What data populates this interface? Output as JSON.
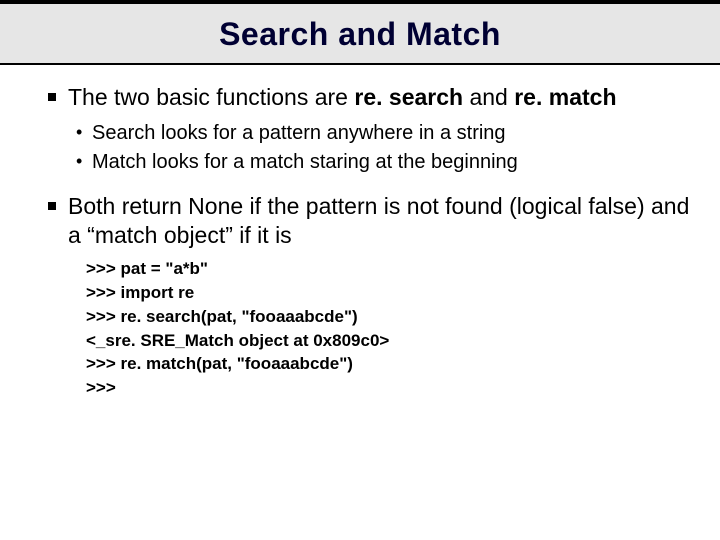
{
  "title": "Search and Match",
  "bullets": {
    "b1_pre": "The two basic functions are ",
    "b1_bold1": "re. search",
    "b1_mid": " and ",
    "b1_bold2": "re. match",
    "b1_sub1": "Search looks for a pattern anywhere in a string",
    "b1_sub2": "Match looks for a match staring at the beginning",
    "b2": "Both return None if the pattern is not found (logical false)  and a “match object” if it is"
  },
  "code": [
    ">>> pat = \"a*b\"",
    ">>> import re",
    ">>> re. search(pat, \"fooaaabcde\")",
    "<_sre. SRE_Match object at 0x809c0>",
    ">>> re. match(pat, \"fooaaabcde\")",
    ">>>"
  ]
}
